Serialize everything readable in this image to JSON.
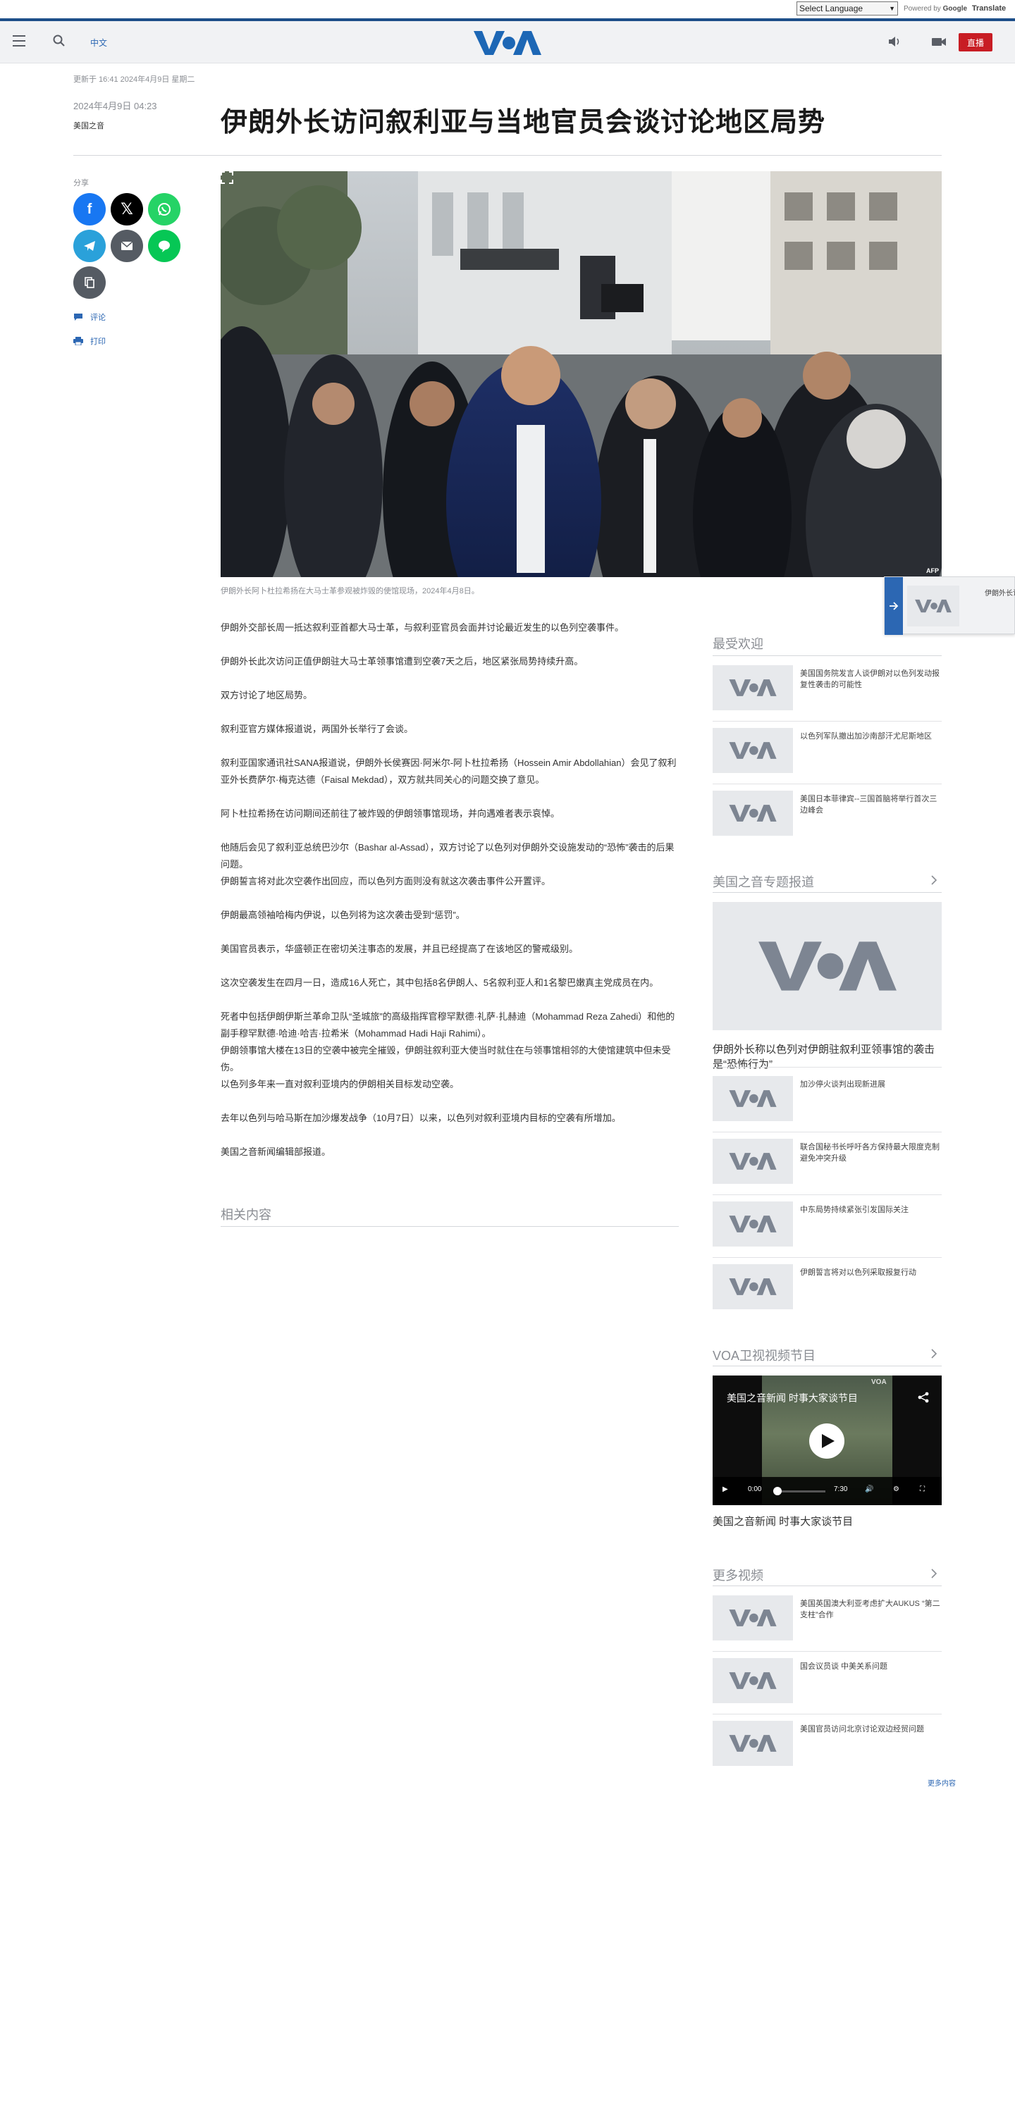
{
  "translate": {
    "select_label": "Select Language",
    "powered_by": "Powered by",
    "google": "Google",
    "translate_word": "Translate"
  },
  "header": {
    "lang_link": "中文",
    "logo_text": "VOA",
    "live_label": "直播"
  },
  "article": {
    "updated": "更新于 16:41 2024年4月9日 星期二",
    "published": "2024年4月9日 04:23",
    "byline": "美国之音",
    "headline": "伊朗外长访问叙利亚与当地官员会谈讨论地区局势",
    "image_credit": "AFP",
    "caption": "伊朗外长阿卜杜拉希扬在大马士革参观被炸毁的使馆现场，2024年4月8日。",
    "paragraphs": [
      "伊朗外交部长周一抵达叙利亚首都大马士革，与叙利亚官员会面并讨论最近发生的以色列空袭事件。",
      "伊朗外长此次访问正值伊朗驻大马士革领事馆遭到空袭7天之后，地区紧张局势持续升高。",
      "双方讨论了地区局势。",
      "叙利亚官方媒体报道说，两国外长举行了会谈。",
      "叙利亚国家通讯社SANA报道说，伊朗外长侯赛因·阿米尔-阿卜杜拉希扬（Hossein Amir Abdollahian）会见了叙利亚外长费萨尔·梅克达德（Faisal Mekdad），双方就共同关心的问题交换了意见。",
      "阿卜杜拉希扬在访问期间还前往了被炸毁的伊朗领事馆现场，并向遇难者表示哀悼。",
      "他随后会见了叙利亚总统巴沙尔（Bashar al-Assad），双方讨论了以色列对伊朗外交设施发动的“恐怖”袭击的后果问题。",
      "伊朗誓言将对此次空袭作出回应，而以色列方面则没有就这次袭击事件公开置评。",
      "伊朗最高领袖哈梅内伊说，以色列将为这次袭击受到“惩罚”。",
      "美国官员表示，华盛顿正在密切关注事态的发展，并且已经提高了在该地区的警戒级别。",
      "这次空袭发生在四月一日，造成16人死亡，其中包括8名伊朗人、5名叙利亚人和1名黎巴嫩真主党成员在内。",
      "死者中包括伊朗伊斯兰革命卫队“圣城旅”的高级指挥官穆罕默德·礼萨·扎赫迪（Mohammad Reza Zahedi）和他的副手穆罕默德·哈迪·哈吉·拉希米（Mohammad Hadi Haji Rahimi）。",
      "伊朗领事馆大楼在13日的空袭中被完全摧毁，伊朗驻叙利亚大使当时就住在与领事馆相邻的大使馆建筑中但未受伤。",
      "以色列多年来一直对叙利亚境内的伊朗相关目标发动空袭。",
      "去年以色列与哈马斯在加沙爆发战争（10月7日）以来，以色列对叙利亚境内目标的空袭有所增加。",
      "美国之音新闻编辑部报道。"
    ],
    "related_heading": "相关内容"
  },
  "rail": {
    "popular": {
      "heading": "最受欢迎",
      "items": [
        "美国国务院发言人谈伊朗对以色列发动报复性袭击的可能性",
        "以色列军队撤出加沙南部汗尤尼斯地区",
        "美国日本菲律宾--三国首脑将举行首次三边峰会"
      ]
    },
    "featured": {
      "heading": "美国之音专题报道",
      "big_title": "伊朗外长称以色列对伊朗驻叙利亚领事馆的袭击是“恐怖行为”",
      "items": [
        "加沙停火谈判出现新进展",
        "联合国秘书长呼吁各方保持最大限度克制 避免冲突升级",
        "中东局势持续紧张引发国际关注",
        "伊朗誓言将对以色列采取报复行动"
      ]
    },
    "video": {
      "heading": "VOA卫视视频节目",
      "player_title": "美国之音新闻 时事大家谈节目",
      "time_current": "0:00",
      "time_total": "7:30",
      "caption": "美国之音新闻 时事大家谈节目"
    },
    "more": {
      "heading": "更多视频",
      "items": [
        "美国英国澳大利亚考虑扩大AUKUS “第二支柱”合作",
        "国会议员谈 中美关系问题",
        "美国官员访问北京讨论双边经贸问题"
      ],
      "more_link": "更多内容"
    }
  },
  "floating": {
    "text": "伊朗外长访问叙利亚"
  },
  "colors": {
    "brand_blue": "#1d4e89",
    "link_blue": "#2c67b3",
    "live_red": "#c81d24"
  },
  "icons": [
    "menu-icon",
    "search-icon",
    "speaker-icon",
    "video-camera-icon",
    "facebook-icon",
    "x-icon",
    "whatsapp-icon",
    "telegram-icon",
    "email-icon",
    "line-icon",
    "copy-link-icon",
    "comment-icon",
    "print-icon",
    "expand-icon",
    "chevron-right-icon",
    "play-icon",
    "share-icon",
    "arrow-right-icon"
  ]
}
